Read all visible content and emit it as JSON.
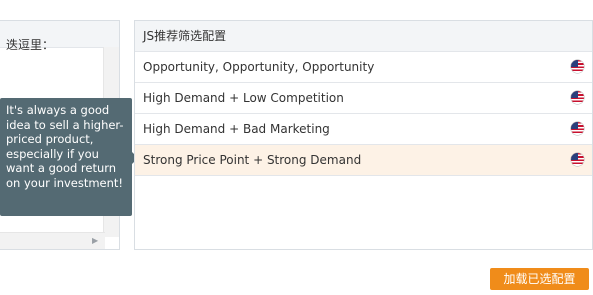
{
  "left_panel": {
    "text": "迭逗里："
  },
  "tooltip": {
    "text": "It's always a good idea to sell a higher-priced product, especially if you want a good return on your investment!"
  },
  "right_panel": {
    "title": "JS推荐筛选配置",
    "rows": [
      {
        "label": "Opportunity, Opportunity, Opportunity",
        "icon": "us-flag-icon",
        "selected": false
      },
      {
        "label": "High Demand + Low Competition",
        "icon": "us-flag-icon",
        "selected": false
      },
      {
        "label": "High Demand + Bad Marketing",
        "icon": "us-flag-icon",
        "selected": false
      },
      {
        "label": "Strong Price Point + Strong Demand",
        "icon": "us-flag-icon",
        "selected": true
      }
    ]
  },
  "load_button": {
    "label": "加载已选配置"
  },
  "colors": {
    "accent": "#f08c1a",
    "tooltip_bg": "#546a73",
    "selected_row_bg": "#fdf2e6"
  }
}
